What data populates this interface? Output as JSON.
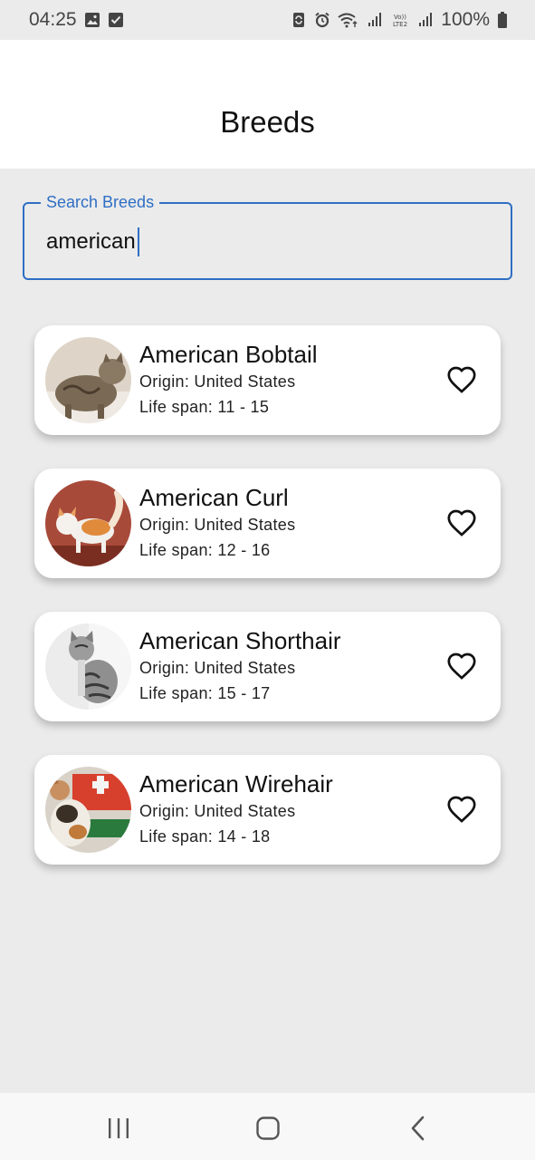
{
  "status_bar": {
    "time": "04:25",
    "battery": "100%"
  },
  "app_bar": {
    "title": "Breeds"
  },
  "search": {
    "label": "Search Breeds",
    "value": "american"
  },
  "breeds": [
    {
      "name": "American Bobtail",
      "origin": "Origin: United States",
      "life_span": "Life span: 11 - 15",
      "favorite": false
    },
    {
      "name": "American Curl",
      "origin": "Origin: United States",
      "life_span": "Life span: 12 - 16",
      "favorite": false
    },
    {
      "name": "American Shorthair",
      "origin": "Origin: United States",
      "life_span": "Life span: 15 - 17",
      "favorite": false
    },
    {
      "name": "American Wirehair",
      "origin": "Origin: United States",
      "life_span": "Life span: 14 - 18",
      "favorite": false
    }
  ],
  "colors": {
    "accent": "#2f6fc4",
    "background": "#ebebeb",
    "card": "#ffffff"
  },
  "icons": {
    "favorite": "heart-outline-icon",
    "nav_recents": "recents-icon",
    "nav_home": "home-icon",
    "nav_back": "back-icon"
  }
}
